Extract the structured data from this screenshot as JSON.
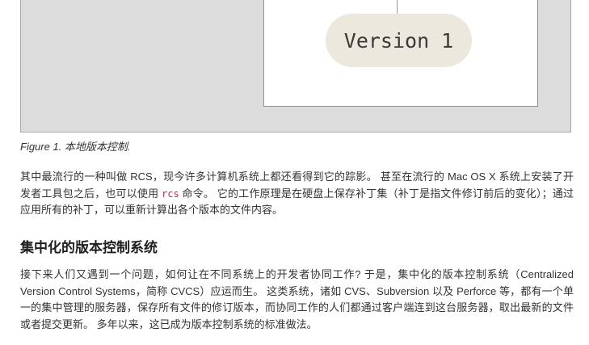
{
  "figure": {
    "version_label": "Version 1",
    "caption": "Figure 1. 本地版本控制."
  },
  "paragraph1": {
    "part1": "其中最流行的一种叫做 RCS，现今许多计算机系统上都还看得到它的踪影。 甚至在流行的 Mac OS X 系统上安装了开发者工具包之后，也可以使用 ",
    "code": "rcs",
    "part2": " 命令。 它的工作原理是在硬盘上保存补丁集（补丁是指文件修订前后的变化）；通过应用所有的补丁，可以重新计算出各个版本的文件内容。"
  },
  "section": {
    "heading": "集中化的版本控制系统"
  },
  "paragraph2": {
    "text": "接下来人们又遇到一个问题，如何让在不同系统上的开发者协同工作?                    于是，集中化的版本控制系统（Centralized Version Control Systems，简称 CVCS）应运而生。 这类系统，诸如 CVS、Subversion 以及 Perforce    等，都有一个单一的集中管理的服务器，保存所有文件的修订版本，而协同工作的人们都通过客户端连到这台服务器，取出最新的文件或者提交更新。 多年以来，这已成为版本控制系统的标准做法。"
  }
}
